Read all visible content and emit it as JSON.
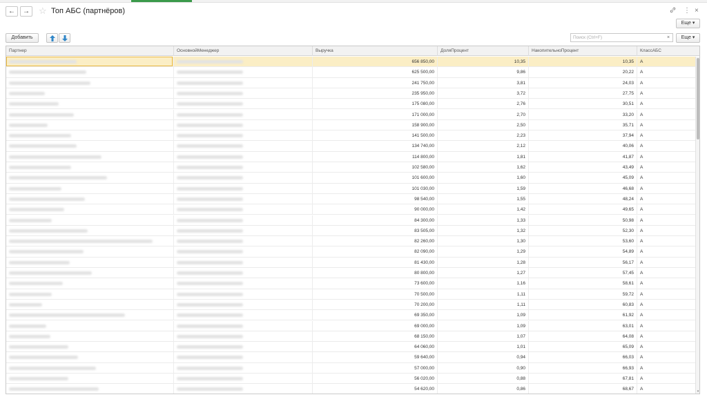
{
  "window": {
    "title": "Топ АБС (партнёров)",
    "back_icon": "←",
    "forward_icon": "→",
    "link_icon": "🔗",
    "menu_icon": "⋮",
    "close_icon": "×"
  },
  "toolbar": {
    "add_label": "Добавить",
    "more_label_top": "Еще",
    "more_label": "Еще",
    "search_placeholder": "Поиск (Ctrl+F)",
    "clear_label": "×"
  },
  "table": {
    "columns": [
      "Партнер",
      "ОсновнойМенеджер",
      "Выручка",
      "ДоляПроцент",
      "НакопительноПроцент",
      "КлассАБС"
    ],
    "rows": [
      {
        "revenue": "656 850,00",
        "share": "10,35",
        "cumulative": "10,35",
        "class": "A"
      },
      {
        "revenue": "625 500,00",
        "share": "9,86",
        "cumulative": "20,22",
        "class": "A"
      },
      {
        "revenue": "241 750,00",
        "share": "3,81",
        "cumulative": "24,03",
        "class": "A"
      },
      {
        "revenue": "235 950,00",
        "share": "3,72",
        "cumulative": "27,75",
        "class": "A"
      },
      {
        "revenue": "175 080,00",
        "share": "2,76",
        "cumulative": "30,51",
        "class": "A"
      },
      {
        "revenue": "171 000,00",
        "share": "2,70",
        "cumulative": "33,20",
        "class": "A"
      },
      {
        "revenue": "158 900,00",
        "share": "2,50",
        "cumulative": "35,71",
        "class": "A"
      },
      {
        "revenue": "141 500,00",
        "share": "2,23",
        "cumulative": "37,94",
        "class": "A"
      },
      {
        "revenue": "134 740,00",
        "share": "2,12",
        "cumulative": "40,06",
        "class": "A"
      },
      {
        "revenue": "114 800,00",
        "share": "1,81",
        "cumulative": "41,87",
        "class": "A"
      },
      {
        "revenue": "102 580,00",
        "share": "1,62",
        "cumulative": "43,49",
        "class": "A"
      },
      {
        "revenue": "101 600,00",
        "share": "1,60",
        "cumulative": "45,09",
        "class": "A"
      },
      {
        "revenue": "101 030,00",
        "share": "1,59",
        "cumulative": "46,68",
        "class": "A"
      },
      {
        "revenue": "98 540,00",
        "share": "1,55",
        "cumulative": "48,24",
        "class": "A"
      },
      {
        "revenue": "90 000,00",
        "share": "1,42",
        "cumulative": "49,65",
        "class": "A"
      },
      {
        "revenue": "84 300,00",
        "share": "1,33",
        "cumulative": "50,98",
        "class": "A"
      },
      {
        "revenue": "83 505,00",
        "share": "1,32",
        "cumulative": "52,30",
        "class": "A"
      },
      {
        "revenue": "82 260,00",
        "share": "1,30",
        "cumulative": "53,60",
        "class": "A"
      },
      {
        "revenue": "82 090,00",
        "share": "1,29",
        "cumulative": "54,89",
        "class": "A"
      },
      {
        "revenue": "81 430,00",
        "share": "1,28",
        "cumulative": "56,17",
        "class": "A"
      },
      {
        "revenue": "80 800,00",
        "share": "1,27",
        "cumulative": "57,45",
        "class": "A"
      },
      {
        "revenue": "73 600,00",
        "share": "1,16",
        "cumulative": "58,61",
        "class": "A"
      },
      {
        "revenue": "70 500,00",
        "share": "1,11",
        "cumulative": "59,72",
        "class": "A"
      },
      {
        "revenue": "70 200,00",
        "share": "1,11",
        "cumulative": "60,83",
        "class": "A"
      },
      {
        "revenue": "69 350,00",
        "share": "1,09",
        "cumulative": "61,92",
        "class": "A"
      },
      {
        "revenue": "69 000,00",
        "share": "1,09",
        "cumulative": "63,01",
        "class": "A"
      },
      {
        "revenue": "68 150,00",
        "share": "1,07",
        "cumulative": "64,08",
        "class": "A"
      },
      {
        "revenue": "64 060,00",
        "share": "1,01",
        "cumulative": "65,09",
        "class": "A"
      },
      {
        "revenue": "59 640,00",
        "share": "0,94",
        "cumulative": "66,03",
        "class": "A"
      },
      {
        "revenue": "57 000,00",
        "share": "0,90",
        "cumulative": "66,93",
        "class": "A"
      },
      {
        "revenue": "56 020,00",
        "share": "0,88",
        "cumulative": "67,81",
        "class": "A"
      },
      {
        "revenue": "54 620,00",
        "share": "0,86",
        "cumulative": "68,67",
        "class": "A"
      }
    ]
  },
  "colors": {
    "selected_row": "#fbeec5",
    "focus_border": "#e9b841",
    "arrow_blue": "#2f86c8",
    "active_tab": "#3a9a4a"
  }
}
